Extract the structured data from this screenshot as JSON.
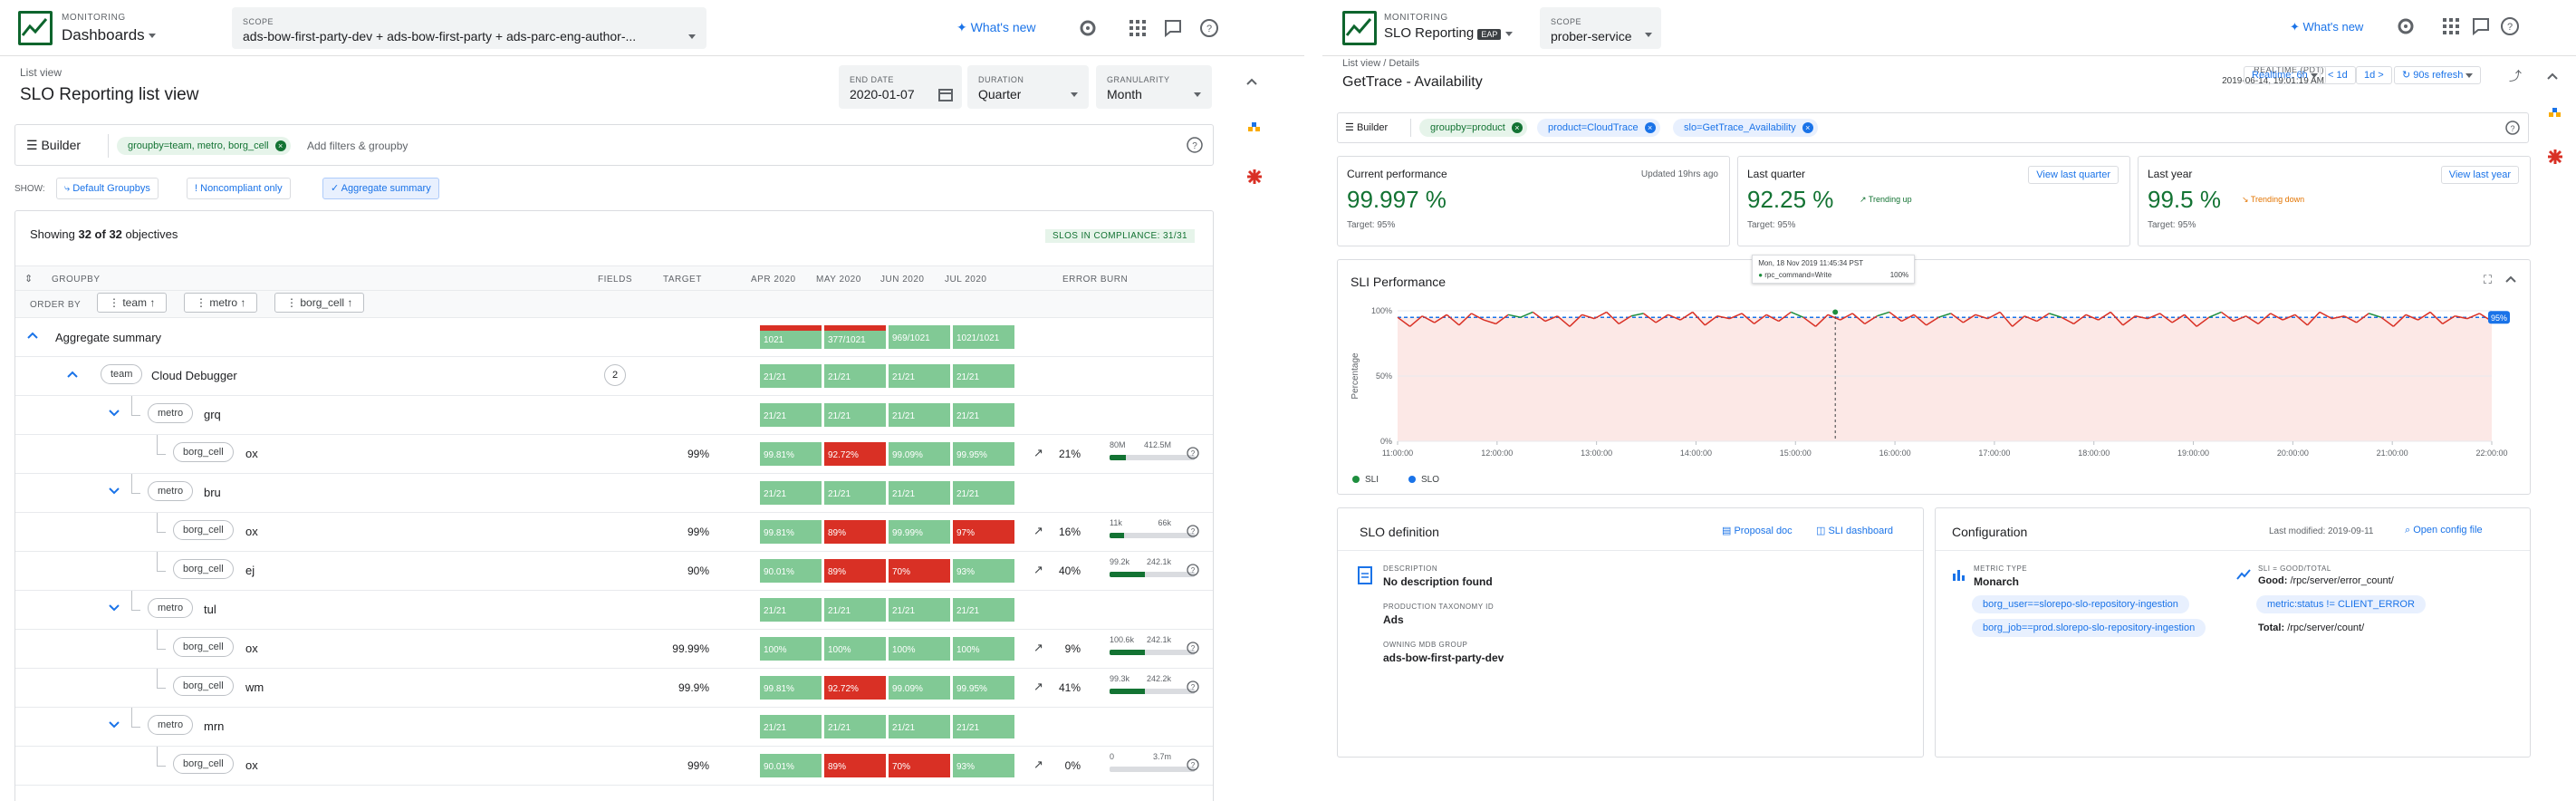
{
  "left": {
    "app_top": "MONITORING",
    "app_name": "Dashboards",
    "scope_label": "SCOPE",
    "scope_value": "ads-bow-first-party-dev + ads-bow-first-party + ads-parc-eng-author-...",
    "whats_new": "What's new",
    "breadcrumb": "List view",
    "title": "SLO Reporting list view",
    "end_date_label": "END DATE",
    "end_date": "2020-01-07",
    "duration_label": "DURATION",
    "duration": "Quarter",
    "granularity_label": "GRANULARITY",
    "granularity": "Month",
    "builder": "Builder",
    "filter_chip": "groupby=team, metro, borg_cell",
    "add_filters_placeholder": "Add filters & groupby",
    "show_label": "SHOW:",
    "show_buttons": [
      "Default Groupbys",
      "Noncompliant only",
      "Aggregate summary"
    ],
    "showing_prefix": "Showing ",
    "showing_count": "32 of 32",
    "showing_suffix": " objectives",
    "compliance": "SLOS IN COMPLIANCE: 31/31",
    "col_headers": {
      "groupby": "GROUPBY",
      "fields": "FIELDS",
      "target": "TARGET",
      "apr": "APR 2020",
      "may": "MAY 2020",
      "jun": "JUN 2020",
      "jul": "JUL 2020",
      "burn": "ERROR BURN"
    },
    "order_by": "ORDER BY",
    "order_keys": [
      "team",
      "metro",
      "borg_cell"
    ],
    "rows": [
      {
        "type": "agg",
        "label": "Aggregate summary",
        "cells": [
          "1021",
          "377/1021",
          "969/1021",
          "1021/1021"
        ],
        "colors": [
          "g",
          "g",
          "g",
          "g"
        ],
        "topred": [
          true,
          true,
          false,
          false
        ]
      },
      {
        "type": "team",
        "key": "team",
        "label": "Cloud Debugger",
        "badge": "2",
        "cells": [
          "21/21",
          "21/21",
          "21/21",
          "21/21"
        ],
        "colors": [
          "g",
          "g",
          "g",
          "g"
        ]
      },
      {
        "type": "metro",
        "key": "metro",
        "label": "grq",
        "cells": [
          "21/21",
          "21/21",
          "21/21",
          "21/21"
        ],
        "colors": [
          "g",
          "g",
          "g",
          "g"
        ]
      },
      {
        "type": "cell",
        "key": "borg_cell",
        "label": "ox",
        "target": "99%",
        "cells": [
          "99.81%",
          "92.72%",
          "99.09%",
          "99.95%"
        ],
        "colors": [
          "g",
          "r",
          "g",
          "g"
        ],
        "burn_pct": "21%",
        "burn_used": "80M",
        "burn_total": "412.5M",
        "burn_fill": 0.19
      },
      {
        "type": "metro",
        "key": "metro",
        "label": "bru",
        "cells": [
          "21/21",
          "21/21",
          "21/21",
          "21/21"
        ],
        "colors": [
          "g",
          "g",
          "g",
          "g"
        ]
      },
      {
        "type": "cell",
        "key": "borg_cell",
        "label": "ox",
        "target": "99%",
        "cells": [
          "99.81%",
          "89%",
          "99.99%",
          "97%"
        ],
        "colors": [
          "g",
          "r",
          "g",
          "r"
        ],
        "burn_pct": "16%",
        "burn_used": "11k",
        "burn_total": "66k",
        "burn_fill": 0.17
      },
      {
        "type": "cell",
        "key": "borg_cell",
        "label": "ej",
        "target": "90%",
        "cells": [
          "90.01%",
          "89%",
          "70%",
          "93%"
        ],
        "colors": [
          "g",
          "r",
          "r",
          "g"
        ],
        "burn_pct": "40%",
        "burn_used": "99.2k",
        "burn_total": "242.1k",
        "burn_fill": 0.41
      },
      {
        "type": "metro",
        "key": "metro",
        "label": "tul",
        "cells": [
          "21/21",
          "21/21",
          "21/21",
          "21/21"
        ],
        "colors": [
          "g",
          "g",
          "g",
          "g"
        ]
      },
      {
        "type": "cell",
        "key": "borg_cell",
        "label": "ox",
        "target": "99.99%",
        "cells": [
          "100%",
          "100%",
          "100%",
          "100%"
        ],
        "colors": [
          "g",
          "g",
          "g",
          "g"
        ],
        "burn_pct": "9%",
        "burn_used": "100.6k",
        "burn_total": "242.1k",
        "burn_fill": 0.42
      },
      {
        "type": "cell",
        "key": "borg_cell",
        "label": "wm",
        "target": "99.9%",
        "cells": [
          "99.81%",
          "92.72%",
          "99.09%",
          "99.95%"
        ],
        "colors": [
          "g",
          "r",
          "g",
          "g"
        ],
        "burn_pct": "41%",
        "burn_used": "99.3k",
        "burn_total": "242.2k",
        "burn_fill": 0.41
      },
      {
        "type": "metro",
        "key": "metro",
        "label": "mrn",
        "cells": [
          "21/21",
          "21/21",
          "21/21",
          "21/21"
        ],
        "colors": [
          "g",
          "g",
          "g",
          "g"
        ]
      },
      {
        "type": "cell",
        "key": "borg_cell",
        "label": "ox",
        "target": "99%",
        "cells": [
          "90.01%",
          "89%",
          "70%",
          "93%"
        ],
        "colors": [
          "g",
          "r",
          "r",
          "g"
        ],
        "burn_pct": "0%",
        "burn_used": "0",
        "burn_total": "3.7m",
        "burn_fill": 0.0
      }
    ]
  },
  "right": {
    "app_top": "MONITORING",
    "app_name": "SLO Reporting",
    "app_badge": "EAP",
    "scope_label": "SCOPE",
    "scope_value": "prober-service",
    "whats_new": "What's new",
    "breadcrumb_1": "List view",
    "breadcrumb_sep": "/",
    "breadcrumb_2": "Details",
    "title": "GetTrace - Availability",
    "realtime_label": "REALTIME (PDT)",
    "realtime_value": "2019-06-14, 19:01:19 AM",
    "time_buttons": [
      "Realtime: 6h",
      "< 1d",
      "1d >",
      "90s refresh"
    ],
    "builder": "Builder",
    "chips": [
      "groupby=product",
      "product=CloudTrace",
      "slo=GetTrace_Availability"
    ],
    "current": {
      "label": "Current performance",
      "updated": "Updated 19hrs ago",
      "value": "99.997 %",
      "target": "Target: 95%"
    },
    "quarter": {
      "label": "Last quarter",
      "button": "View last quarter",
      "value": "92.25 %",
      "trend": "Trending up",
      "target": "Target: 95%"
    },
    "year": {
      "label": "Last year",
      "button": "View last year",
      "value": "99.5 %",
      "trend": "Trending down",
      "target": "Target: 95%"
    },
    "sli_title": "SLI Performance",
    "tooltip_date": "Mon, 18 Nov 2019 11:45:34 PST",
    "tooltip_series": "rpc_command=Write",
    "tooltip_value": "100%",
    "slo_def_title": "SLO definition",
    "proposal_doc": "Proposal doc",
    "sli_dashboard": "SLI dashboard",
    "description_label": "DESCRIPTION",
    "description": "No description found",
    "taxonomy_label": "PRODUCTION TAXONOMY ID",
    "taxonomy": "Ads",
    "owning_label": "OWNING MDB GROUP",
    "owning": "ads-bow-first-party-dev",
    "config_title": "Configuration",
    "last_modified": "Last modified: 2019-09-11",
    "open_config": "Open config file",
    "metric_type_label": "METRIC TYPE",
    "metric_type": "Monarch",
    "metric_chips": [
      "borg_user==slorepo-slo-repository-ingestion",
      "borg_job==prod.slorepo-slo-repository-ingestion"
    ],
    "sli_formula_label": "SLI = GOOD/TOTAL",
    "good_label": "Good:",
    "good_value": "/rpc/server/error_count/",
    "good_chip": "metric:status != CLIENT_ERROR",
    "total_label": "Total:",
    "total_value": "/rpc/server/count/"
  },
  "chart_data": {
    "type": "line",
    "title": "SLI Performance",
    "xlabel": "",
    "ylabel": "Percentage",
    "x_ticks": [
      "11:00:00",
      "12:00:00",
      "13:00:00",
      "14:00:00",
      "15:00:00",
      "16:00:00",
      "17:00:00",
      "18:00:00",
      "19:00:00",
      "20:00:00",
      "21:00:00",
      "22:00:00"
    ],
    "y_ticks": [
      "0%",
      "50%",
      "100%"
    ],
    "ylim": [
      0,
      100
    ],
    "legend": [
      "SLI",
      "SLO"
    ],
    "threshold_label": "95%",
    "series": [
      {
        "name": "SLI",
        "color": "#1e8e3e",
        "values": [
          95,
          88,
          96,
          91,
          97,
          89,
          98,
          93,
          90,
          97,
          95,
          99,
          92,
          96,
          88,
          97,
          94,
          99,
          90,
          96,
          98,
          91,
          97,
          93,
          99,
          89,
          96,
          94,
          98,
          90,
          97,
          92,
          99,
          95,
          88,
          97,
          93,
          98,
          90,
          96,
          99,
          92,
          97,
          89,
          95,
          98,
          91,
          97,
          94,
          99,
          88,
          96,
          92,
          98,
          95,
          90,
          97,
          93,
          99,
          89,
          96,
          94,
          98,
          91,
          97,
          88,
          95,
          99,
          92,
          96,
          90,
          98,
          93,
          97,
          89,
          99,
          94,
          96,
          91,
          98,
          95,
          88,
          97,
          93,
          99,
          90,
          96,
          94,
          98,
          92
        ]
      },
      {
        "name": "SLO",
        "color": "#1a73e8",
        "values": [
          95,
          95
        ]
      }
    ]
  }
}
